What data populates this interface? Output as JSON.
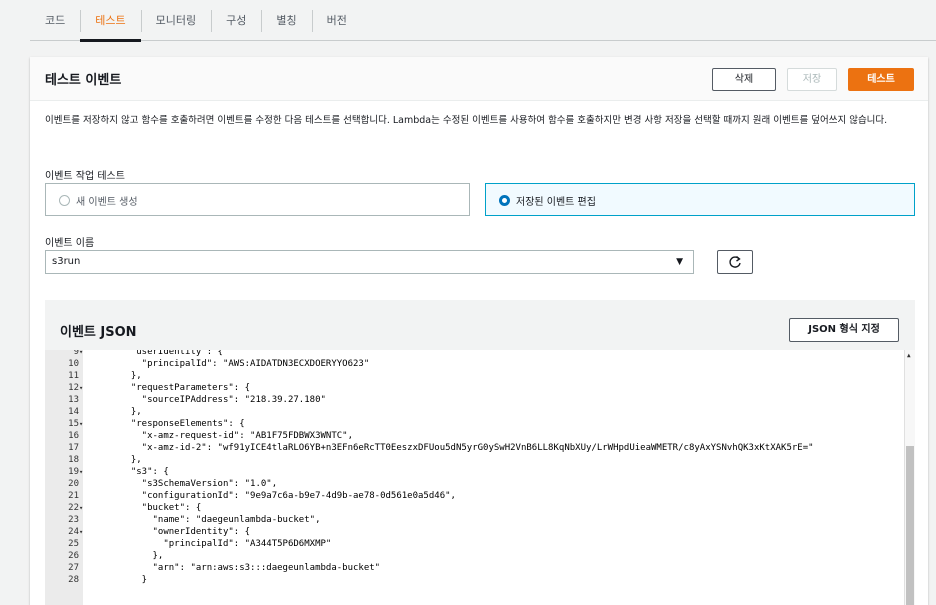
{
  "tabs": [
    "코드",
    "테스트",
    "모니터링",
    "구성",
    "별칭",
    "버전"
  ],
  "active_tab": 1,
  "panel": {
    "title": "테스트 이벤트",
    "delete_label": "삭제",
    "save_label": "저장",
    "test_label": "테스트",
    "description": "이벤트를 저장하지 않고 함수를 호출하려면 이벤트를 수정한 다음 테스트를 선택합니다. Lambda는 수정된 이벤트를 사용하여 함수를 호출하지만 변경 사항 저장을 선택할 때까지 원래 이벤트를 덮어쓰지 않습니다.",
    "action_label": "이벤트 작업 테스트",
    "option_new": "새 이벤트 생성",
    "option_saved": "저장된 이벤트 편집",
    "selected_option": "saved",
    "name_label": "이벤트 이름",
    "name_value": "s3run"
  },
  "json_editor": {
    "title": "이벤트 JSON",
    "format_label": "JSON 형식 지정",
    "lines": [
      {
        "n": "9",
        "fold": "▾",
        "text": "  \"userIdentity\": {"
      },
      {
        "n": "10",
        "fold": "",
        "text": "    \"principalId\": \"AWS:AIDATDN3ECXDOERYYO623\""
      },
      {
        "n": "11",
        "fold": "",
        "text": "  },"
      },
      {
        "n": "12",
        "fold": "▾",
        "text": "  \"requestParameters\": {"
      },
      {
        "n": "13",
        "fold": "",
        "text": "    \"sourceIPAddress\": \"218.39.27.180\""
      },
      {
        "n": "14",
        "fold": "",
        "text": "  },"
      },
      {
        "n": "15",
        "fold": "▾",
        "text": "  \"responseElements\": {"
      },
      {
        "n": "16",
        "fold": "",
        "text": "    \"x-amz-request-id\": \"AB1F75FDBWX3WNTC\","
      },
      {
        "n": "17",
        "fold": "",
        "text": "    \"x-amz-id-2\": \"wf91yICE4tlaRLO6YB+n3EFn6eRcTT0EeszxDFUou5dN5yrG0ySwH2VnB6LL8KqNbXUy/LrWHpdUieaWMETR/c8yAxYSNvhQK3xKtXAK5rE=\""
      },
      {
        "n": "18",
        "fold": "",
        "text": "  },"
      },
      {
        "n": "19",
        "fold": "▾",
        "text": "  \"s3\": {"
      },
      {
        "n": "20",
        "fold": "",
        "text": "    \"s3SchemaVersion\": \"1.0\","
      },
      {
        "n": "21",
        "fold": "",
        "text": "    \"configurationId\": \"9e9a7c6a-b9e7-4d9b-ae78-0d561e0a5d46\","
      },
      {
        "n": "22",
        "fold": "▾",
        "text": "    \"bucket\": {"
      },
      {
        "n": "23",
        "fold": "",
        "text": "      \"name\": \"daegeunlambda-bucket\","
      },
      {
        "n": "24",
        "fold": "▾",
        "text": "      \"ownerIdentity\": {"
      },
      {
        "n": "25",
        "fold": "",
        "text": "        \"principalId\": \"A344T5P6D6MXMP\""
      },
      {
        "n": "26",
        "fold": "",
        "text": "      },"
      },
      {
        "n": "27",
        "fold": "",
        "text": "      \"arn\": \"arn:aws:s3:::daegeunlambda-bucket\""
      },
      {
        "n": "28",
        "fold": "",
        "text": "    }"
      }
    ]
  },
  "icons": {
    "refresh": "refresh-icon",
    "dropdown": "caret-down-icon",
    "scroll_up": "scroll-up-icon"
  },
  "colors": {
    "accent": "#ec7211",
    "selected_border": "#00a1c9",
    "radio_selected": "#0073bb"
  }
}
